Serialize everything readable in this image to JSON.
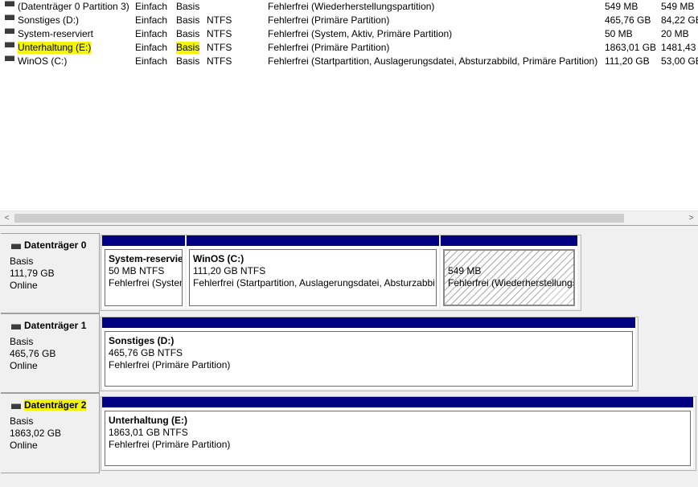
{
  "volumes": [
    {
      "name": "(Datenträger 0 Partition 3)",
      "layout": "Einfach",
      "type": "Basis",
      "fs": "",
      "status": "Fehlerfrei (Wiederherstellungspartition)",
      "capacity": "549 MB",
      "free": "549 MB"
    },
    {
      "name": "Sonstiges (D:)",
      "layout": "Einfach",
      "type": "Basis",
      "fs": "NTFS",
      "status": "Fehlerfrei (Primäre Partition)",
      "capacity": "465,76 GB",
      "free": "84,22 GB"
    },
    {
      "name": "System-reserviert",
      "layout": "Einfach",
      "type": "Basis",
      "fs": "NTFS",
      "status": "Fehlerfrei (System, Aktiv, Primäre Partition)",
      "capacity": "50 MB",
      "free": "20 MB"
    },
    {
      "name": "Unterhaltung (E:)",
      "layout": "Einfach",
      "type": "Basis",
      "fs": "NTFS",
      "status": "Fehlerfrei (Primäre Partition)",
      "capacity": "1863,01 GB",
      "free": "1481,43 G"
    },
    {
      "name": "WinOS (C:)",
      "layout": "Einfach",
      "type": "Basis",
      "fs": "NTFS",
      "status": "Fehlerfrei (Startpartition, Auslagerungsdatei, Absturzabbild, Primäre Partition)",
      "capacity": "111,20 GB",
      "free": "53,00 GB"
    }
  ],
  "scrollbar": {
    "left_arrow": "<",
    "right_arrow": ">"
  },
  "disks": [
    {
      "title": "Datenträger 0",
      "type": "Basis",
      "size": "111,79 GB",
      "status": "Online",
      "partitions": [
        {
          "name": "System-reservie",
          "size": "50 MB NTFS",
          "status": "Fehlerfrei (Systen"
        },
        {
          "name": "WinOS  (C:)",
          "size": "111,20 GB NTFS",
          "status": "Fehlerfrei (Startpartition, Auslagerungsdatei, Absturzabbi"
        },
        {
          "name": "",
          "size": "549 MB",
          "status": "Fehlerfrei (Wiederherstellungs"
        }
      ]
    },
    {
      "title": "Datenträger 1",
      "type": "Basis",
      "size": "465,76 GB",
      "status": "Online",
      "partitions": [
        {
          "name": "Sonstiges  (D:)",
          "size": "465,76 GB NTFS",
          "status": "Fehlerfrei (Primäre Partition)"
        }
      ]
    },
    {
      "title": "Datenträger 2",
      "type": "Basis",
      "size": "1863,02 GB",
      "status": "Online",
      "partitions": [
        {
          "name": "Unterhaltung  (E:)",
          "size": "1863,01 GB NTFS",
          "status": "Fehlerfrei (Primäre Partition)"
        }
      ]
    }
  ],
  "colors": {
    "partition_bar": "#000080",
    "highlight": "#f4f40a",
    "background": "#f0f0f0"
  }
}
